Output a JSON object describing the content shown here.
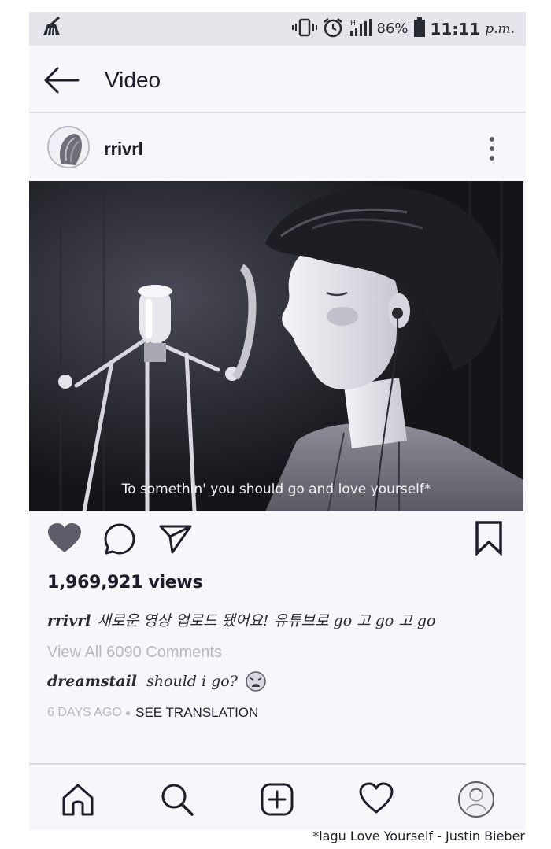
{
  "status_bar": {
    "battery": "86%",
    "time": "11:11",
    "ampm": "p.m."
  },
  "header": {
    "title": "Video"
  },
  "post": {
    "username": "rrivrl",
    "subtitle": "To somethin' you should go and love yourself*",
    "views": "1,969,921 views",
    "caption_user": "rrivrl",
    "caption_text": "새로운 영상 업로드 됐어요! 유튜브로 go 고 go 고 go",
    "view_all_comments": "View All 6090 Comments",
    "comment": {
      "user": "dreamstail",
      "text": "should i go?"
    },
    "time_ago": "6 DAYS AGO",
    "see_translation": "SEE TRANSLATION",
    "liked": true
  },
  "footnote": "*lagu Love Yourself - Justin Bieber",
  "colors": {
    "background": "#f7f6fa",
    "statusbar": "#e6e5ec",
    "icon": "#1e1e2a",
    "like": "#5d5c68",
    "muted_text": "#b9b8c2"
  },
  "icons": {
    "status": [
      "cleaner-icon",
      "vibrate-icon",
      "alarm-icon",
      "signal-icon",
      "battery-icon"
    ],
    "nav": [
      "home-icon",
      "search-icon",
      "add-post-icon",
      "activity-heart-icon",
      "profile-avatar-icon"
    ]
  }
}
